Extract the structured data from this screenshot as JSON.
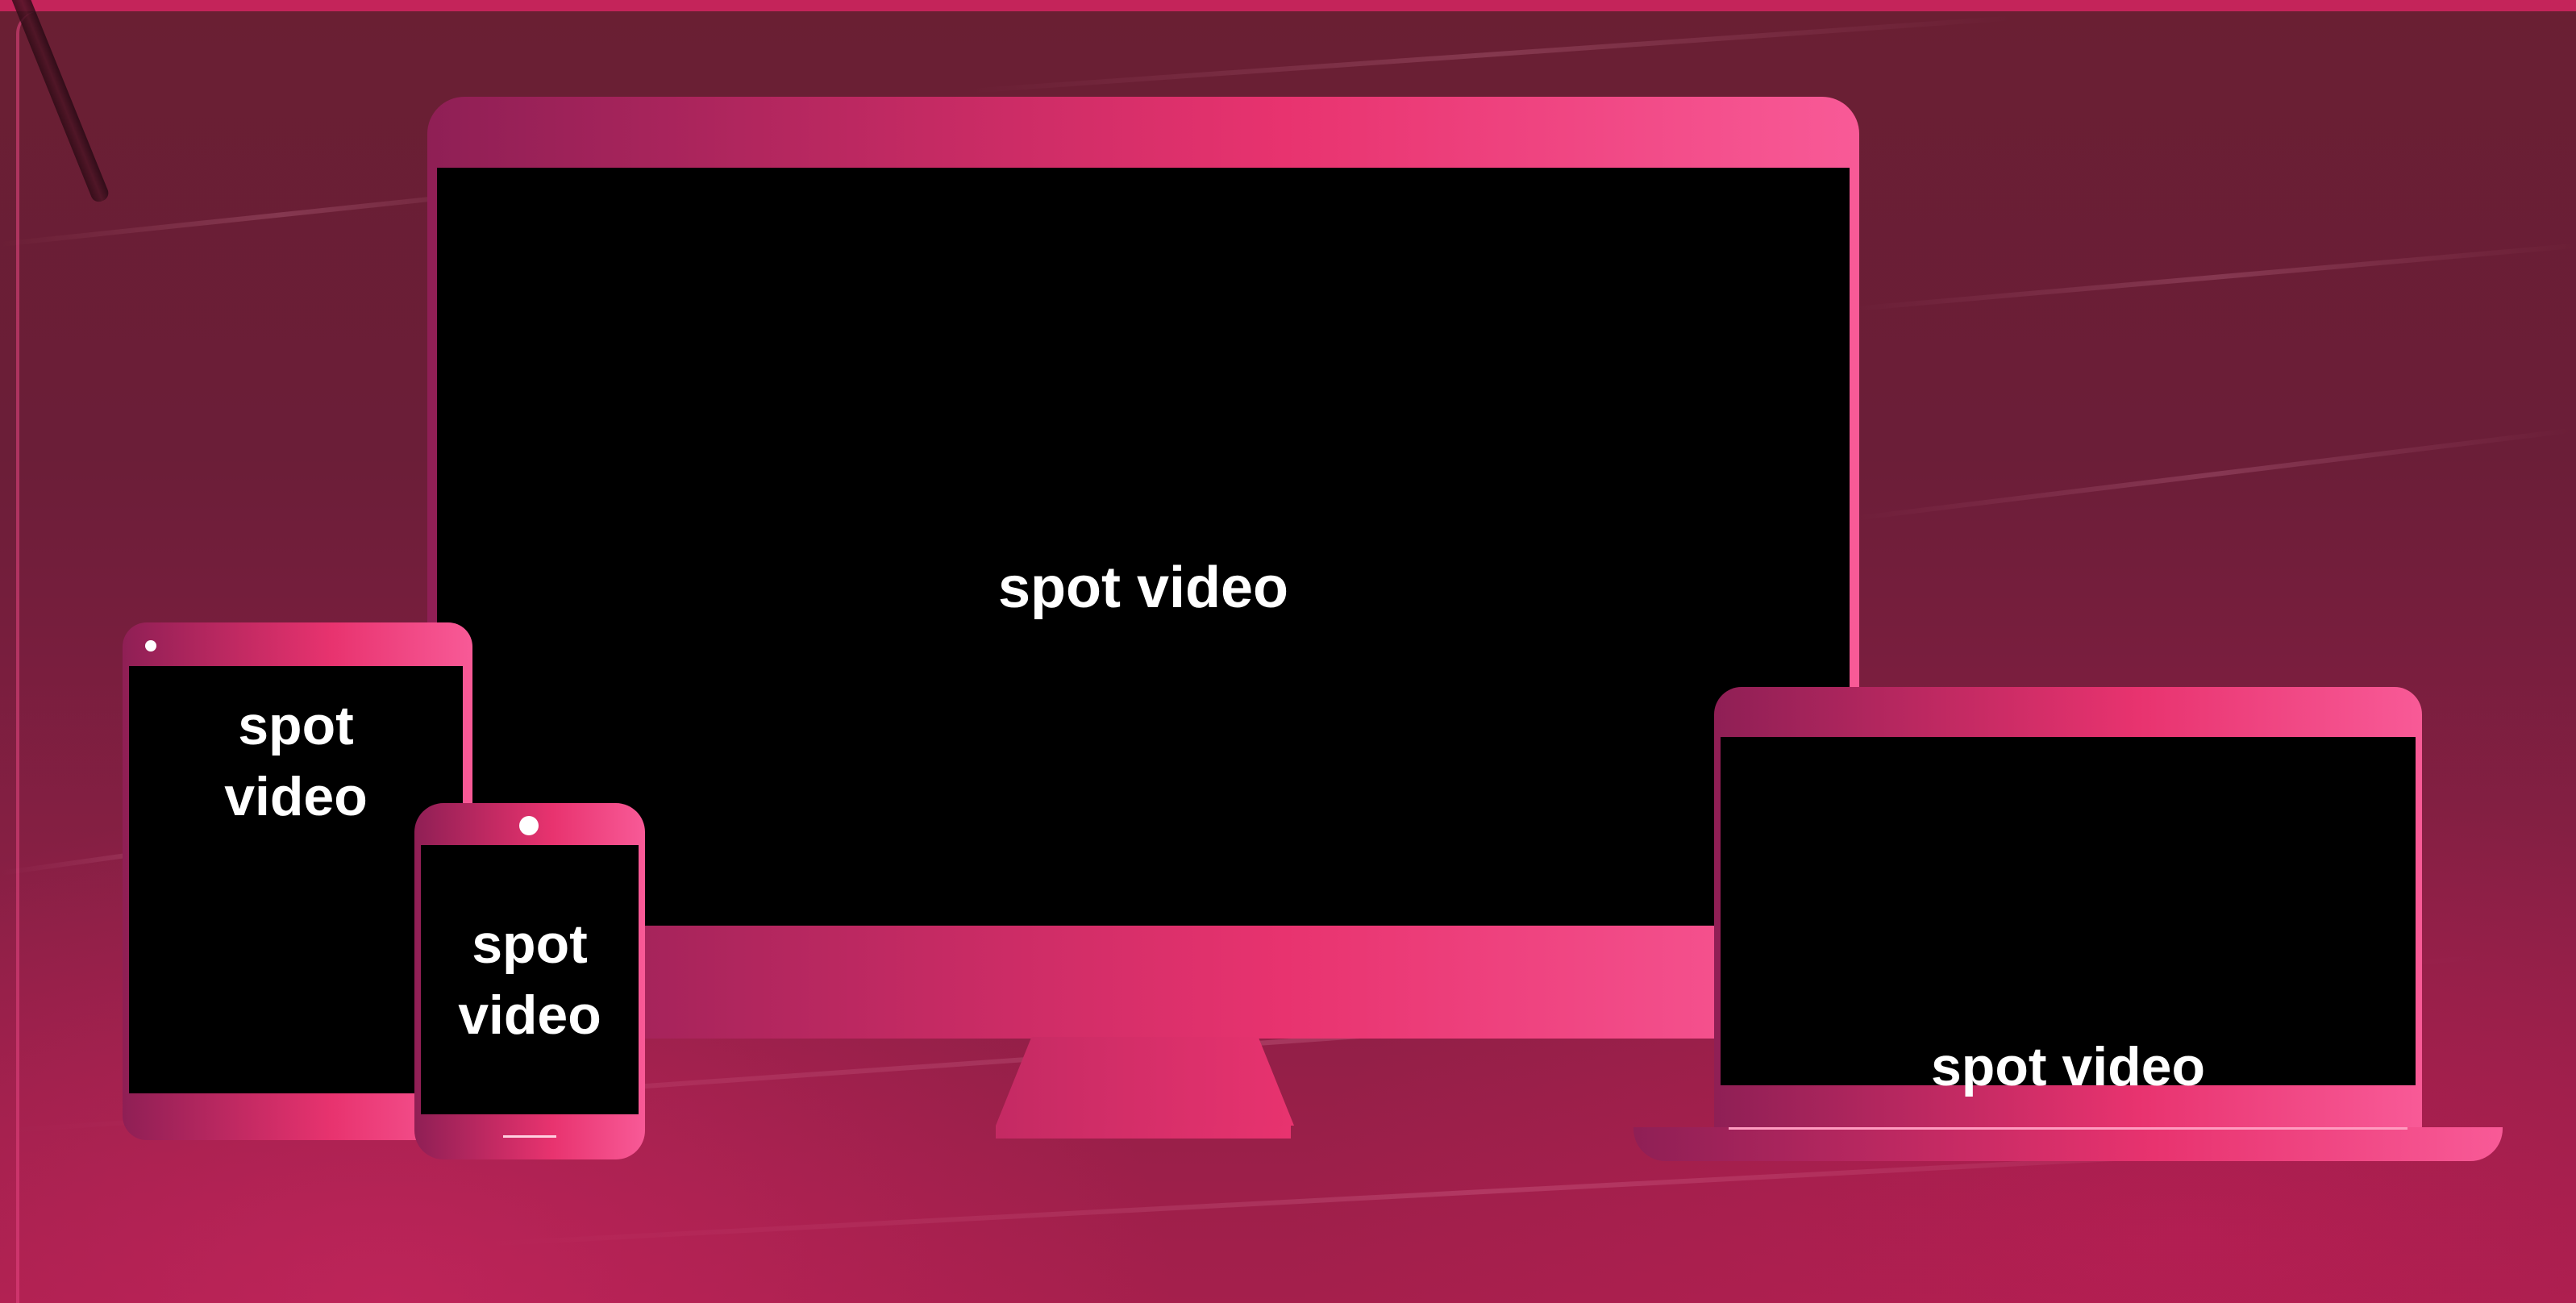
{
  "colors": {
    "background": "#6b1e38",
    "device_pink": "#e8336f",
    "screen": "#000000",
    "text": "#ffffff"
  },
  "devices": {
    "monitor": {
      "label": "spot video"
    },
    "tablet": {
      "label_line1": "spot",
      "label_line2": "video"
    },
    "phone": {
      "label_line1": "spot",
      "label_line2": "video"
    },
    "laptop": {
      "label": "spot video"
    }
  }
}
